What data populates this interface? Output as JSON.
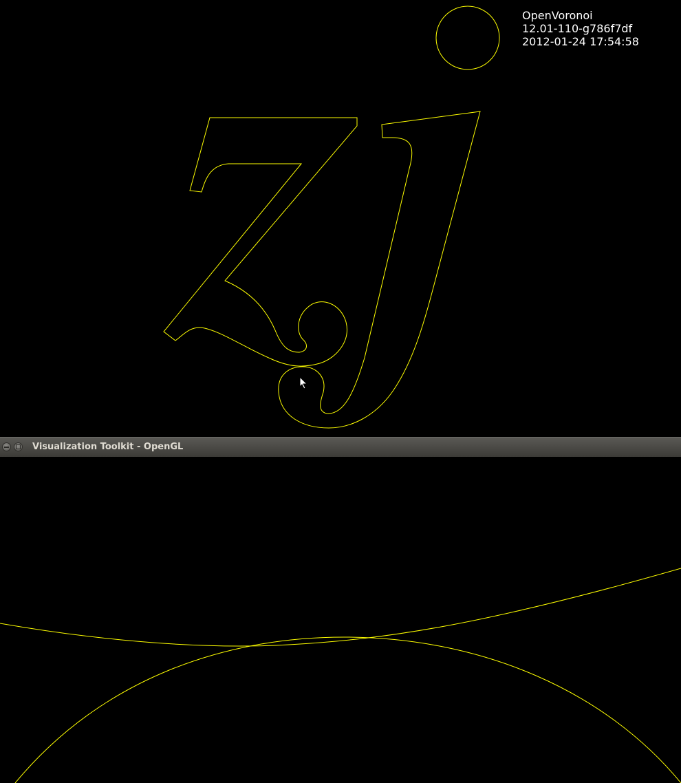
{
  "colors": {
    "background": "#000000",
    "geometry": "#ffff00",
    "info_text": "#ffffff",
    "titlebar": "#3c3b37",
    "title_text": "#dfdbd2"
  },
  "overlay": {
    "app_name": "OpenVoronoi",
    "version": "12.01-110-g786f7df",
    "timestamp": "2012-01-24 17:54:58"
  },
  "window": {
    "title": "Visualization Toolkit - OpenGL",
    "controls": [
      "minimize-icon",
      "maximize-icon"
    ]
  },
  "icons": {
    "pointer": "mouse-pointer-icon"
  }
}
